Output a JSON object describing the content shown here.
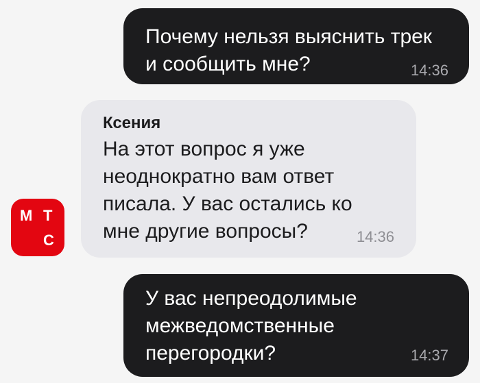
{
  "chat": {
    "messages": [
      {
        "direction": "outgoing",
        "text": "Почему нельзя выяснить трек\nи сообщить мне?",
        "time": "14:36"
      },
      {
        "direction": "incoming",
        "sender": "Ксения",
        "text": "На этот вопрос я уже\nнеоднократно вам ответ\nписала. У вас остались ко\nмне другие вопросы?",
        "time": "14:36"
      },
      {
        "direction": "outgoing",
        "text": "У вас непреодолимые\nмежведомственные\nперегородки?",
        "time": "14:37"
      }
    ]
  },
  "avatar": {
    "letters": [
      "М",
      "Т",
      "С"
    ],
    "brand_color": "#e30611"
  },
  "colors": {
    "background": "#f5f5f5",
    "outgoing_bubble": "#1c1c1e",
    "incoming_bubble": "#e8e8ec",
    "time_text": "#8e8e93"
  }
}
